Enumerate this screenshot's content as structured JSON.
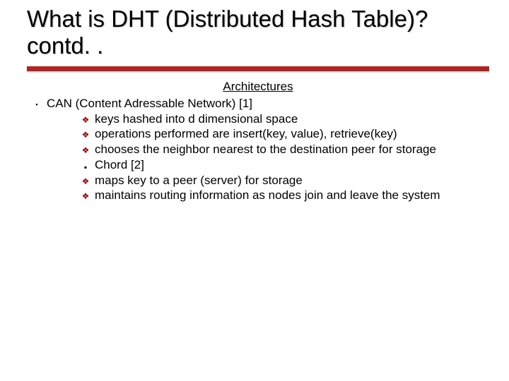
{
  "title": "What is DHT (Distributed Hash Table)? contd. .",
  "subhead": "Architectures",
  "lvl1_text": "CAN (Content Adressable Network) [1]",
  "items": [
    {
      "bullet": "❖",
      "cls": "diamond",
      "text": "keys hashed into d dimensional space"
    },
    {
      "bullet": "❖",
      "cls": "diamond",
      "text": "operations performed are insert(key, value), retrieve(key)"
    },
    {
      "bullet": "❖",
      "cls": "diamond",
      "text": "chooses the neighbor nearest to the destination peer for storage"
    },
    {
      "bullet": "▪",
      "cls": "square",
      "text": "Chord [2]"
    },
    {
      "bullet": "❖",
      "cls": "diamond",
      "text": "maps key to a peer (server) for storage"
    },
    {
      "bullet": "❖",
      "cls": "diamond",
      "text": "maintains routing information as nodes join and leave the system"
    }
  ]
}
